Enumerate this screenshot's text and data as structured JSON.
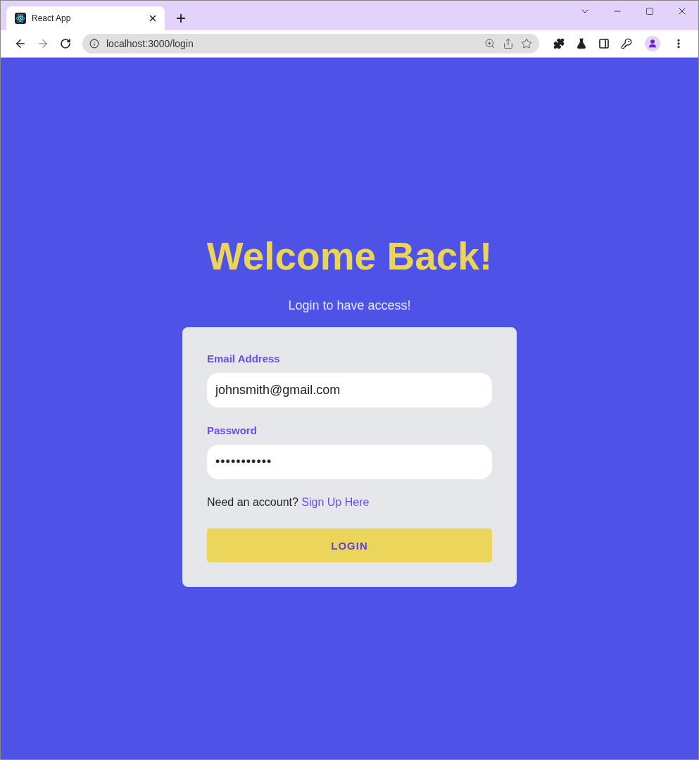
{
  "browser": {
    "tab": {
      "title": "React App",
      "selected": true
    },
    "address": "localhost:3000/login"
  },
  "page": {
    "heading": "Welcome Back!",
    "subtitle": "Login to have access!",
    "form": {
      "fields": [
        {
          "label": "Email Address",
          "value": "johnsmith@gmail.com",
          "kind": "text"
        },
        {
          "label": "Password",
          "value": "•••••••••••",
          "kind": "password"
        }
      ],
      "prompt": "Need an account?",
      "link": "Sign Up Here",
      "button": "LOGIN"
    }
  }
}
